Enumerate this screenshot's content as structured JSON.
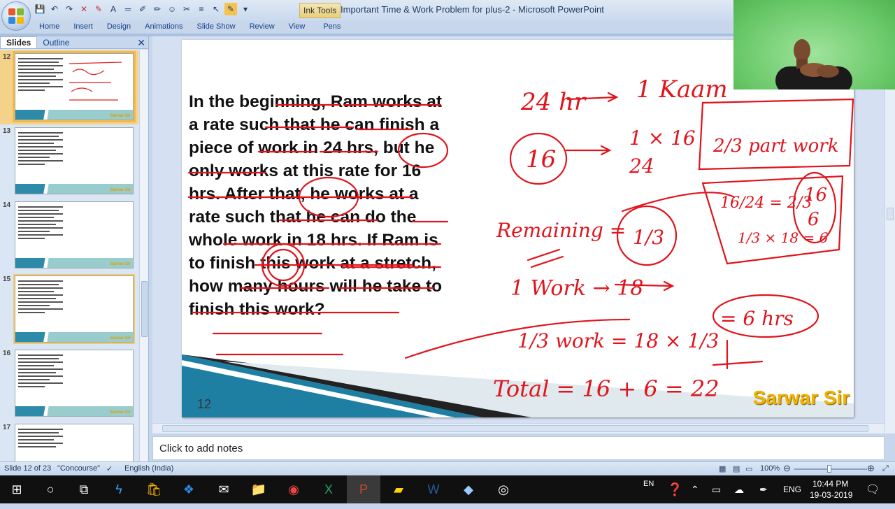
{
  "window": {
    "title": "Important Time & Work Problem for plus-2 - Microsoft PowerPoint",
    "contextual_tab": "Ink Tools"
  },
  "ribbon": {
    "tabs": [
      "Home",
      "Insert",
      "Design",
      "Animations",
      "Slide Show",
      "Review",
      "View"
    ],
    "pens_tab": "Pens"
  },
  "left_pane": {
    "tabs": [
      "Slides",
      "Outline"
    ],
    "close": "✕",
    "thumbnails": [
      {
        "num": "12",
        "selected": true
      },
      {
        "num": "13",
        "selected": false
      },
      {
        "num": "14",
        "selected": false
      },
      {
        "num": "15",
        "selected": false
      },
      {
        "num": "16",
        "selected": false
      },
      {
        "num": "17",
        "selected": false
      }
    ]
  },
  "slide": {
    "question": "In the beginning, Ram works at a rate such that he can finish a piece of work in 24 hrs, but he only works at this rate for 16 hrs. After that, he works at a rate such that he can do the whole work in 18 hrs. If Ram is to finish this work at a stretch, how many hours will he take to finish this work?",
    "number": "12",
    "brand": "Sarwar Sir",
    "ink": {
      "l1": "24 hr",
      "l1b": "1 Kaam",
      "n16": "16",
      "frac1": "1 × 16",
      "frac1d": "24",
      "pw": "2/3 part work",
      "rem": "Remaining =",
      "third": "1/3",
      "box1": "16/24 = 2/3",
      "box2": "1/3 × 18 = 6",
      "box3": "16",
      "box4": "6",
      "w1": "1 Work → 18",
      "w2": "1/3 work = 18 × 1/3",
      "ans": "= 6 hrs",
      "total": "Total = 16 + 6 = 22"
    }
  },
  "notes": {
    "placeholder": "Click to add notes"
  },
  "status": {
    "slide": "Slide 12 of 23",
    "theme": "\"Concourse\"",
    "language": "English (India)",
    "zoom": "100%"
  },
  "taskbar": {
    "lang_top": "EN",
    "lang": "ENG",
    "time": "10:44 PM",
    "date": "19-03-2019"
  }
}
